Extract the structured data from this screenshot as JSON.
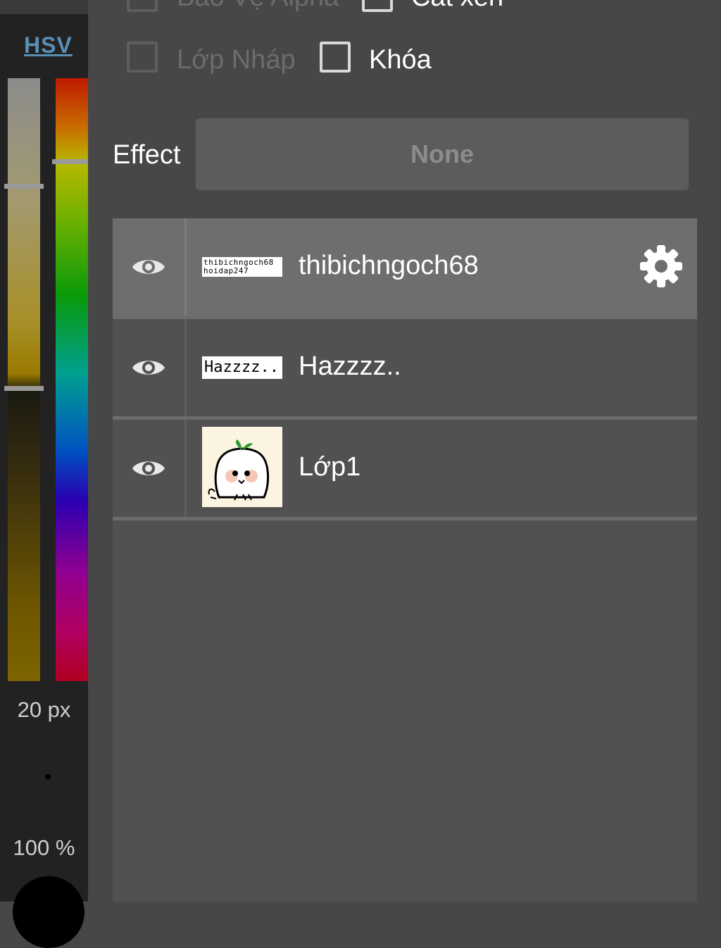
{
  "color_panel": {
    "mode_label": "HSV",
    "brush_size": "20 px",
    "opacity": "100 %"
  },
  "options": {
    "alpha_protect_label": "Bảo Vệ Alpha",
    "clipping_label": "Cắt xén",
    "draft_layer_label": "Lớp Nháp",
    "lock_label": "Khóa"
  },
  "effect": {
    "label": "Effect",
    "value": "None"
  },
  "layers": [
    {
      "name": "thibichngoch68",
      "thumb_line1": "thibichngoch68",
      "thumb_line2": "hoidap247",
      "selected": true
    },
    {
      "name": "Hazzzz..",
      "thumb_text": "Hazzzz..",
      "selected": false
    },
    {
      "name": "Lớp1",
      "selected": false
    }
  ],
  "icons": {
    "visibility": "eye-icon",
    "settings": "gear-icon"
  },
  "colors": {
    "panel_bg": "#474747",
    "list_bg": "#515151",
    "selected_row": "#6e6e6e",
    "accent_link": "#5a8fb5"
  }
}
